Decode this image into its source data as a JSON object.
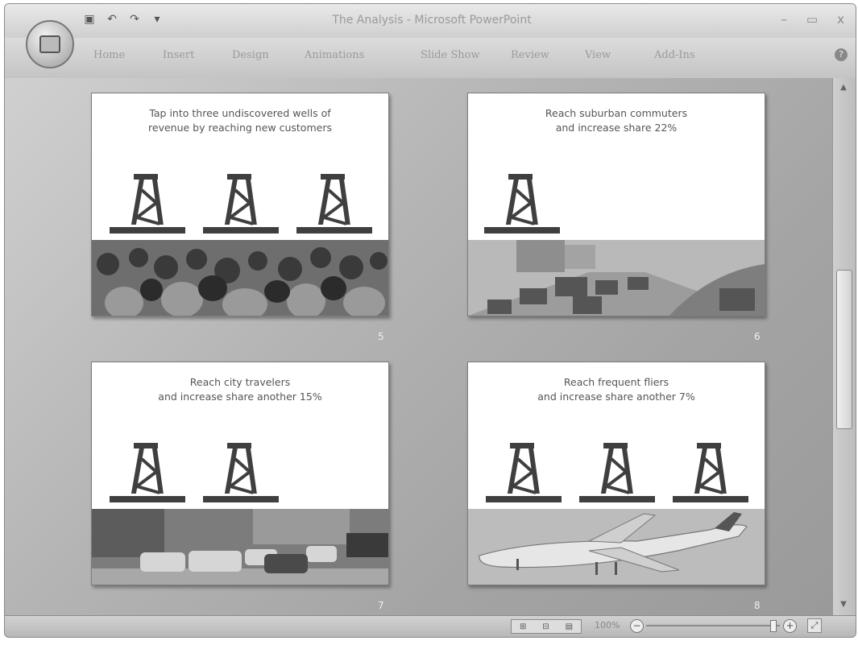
{
  "window": {
    "title": "The Analysis - Microsoft PowerPoint",
    "controls": {
      "minimize": "–",
      "maximize": "▭",
      "close": "x"
    }
  },
  "quick_access": {
    "save_icon": "save-icon",
    "undo_icon": "undo-icon",
    "redo_icon": "redo-icon",
    "customize": "▾"
  },
  "ribbon": {
    "tabs": [
      "Home",
      "Insert",
      "Design",
      "Animations",
      "Slide Show",
      "Review",
      "View",
      "Add-Ins"
    ],
    "help": "?"
  },
  "slides": [
    {
      "number": "5",
      "headline": [
        "Tap into three undiscovered wells of",
        "revenue by reaching new customers"
      ],
      "derricks": 3,
      "photo": "crowd"
    },
    {
      "number": "6",
      "headline": [
        "Reach suburban commuters",
        "and increase share 22%"
      ],
      "derricks": 1,
      "photo": "highway"
    },
    {
      "number": "7",
      "headline": [
        "Reach city travelers",
        "and increase share another 15%"
      ],
      "derricks": 2,
      "photo": "city-street"
    },
    {
      "number": "8",
      "headline": [
        "Reach frequent fliers",
        "and increase share another 7%"
      ],
      "derricks": 3,
      "photo": "airplane"
    }
  ],
  "status_bar": {
    "zoom": "100%",
    "zoom_out": "−",
    "zoom_in": "+",
    "view_buttons": [
      "⊞",
      "⊟",
      "▤"
    ],
    "fit": "⤢"
  },
  "colors": {
    "derrick": "#3f3f3f",
    "canvas": "#b4b4b4"
  }
}
